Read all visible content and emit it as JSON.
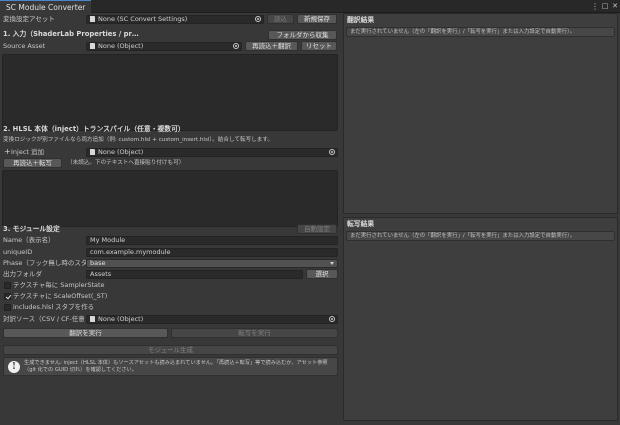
{
  "window": {
    "tab_title": "SC Module Converter",
    "menu_glyph": "⋮",
    "maximize_glyph": "□",
    "close_glyph": "✕"
  },
  "preset": {
    "label": "変換設定アセット",
    "value": "None (SC Convert Settings)",
    "load_label": "読込",
    "save_new_label": "新規保存"
  },
  "section1": {
    "header": "1. 入力（ShaderLab Properties / pr…",
    "collect_folder_label": "フォルダから収集",
    "source_label": "Source Asset",
    "source_value": "None (Object)",
    "reload_translate_label": "再読込＋翻訳",
    "reset_label": "リセット"
  },
  "section2": {
    "header": "2. HLSL 本体（inject）トランスパイル（任意・複数可）",
    "description": "変換ロジックが別ファイルなら両方追加（例: custom.hlsl + custom_insert.hlsl）。結合して転写します。",
    "inject_add_label": "Inject 追加",
    "inject_value": "None (Object)",
    "reload_transcribe_label": "再読込＋転写",
    "note": "（未読込。下のテキストへ直接貼り付けも可）"
  },
  "section3": {
    "header": "3. モジュール設定",
    "auto_setting_label": "自動設定",
    "name_label": "Name（表示名）",
    "name_value": "My Module",
    "uniqueid_label": "uniqueID",
    "uniqueid_value": "com.example.mymodule",
    "phase_label": "Phase（フック無し時のスタブ用",
    "phase_value": "base",
    "output_label": "出力フォルダ",
    "output_value": "Assets",
    "select_label": "選択",
    "checkboxes": [
      {
        "label": "テクスチャ毎に SamplerState",
        "checked": false
      },
      {
        "label": "テクスチャに ScaleOffset(_ST)",
        "checked": true
      },
      {
        "label": "includes.hlsl スタブを作る",
        "checked": false
      }
    ],
    "contrast_label": "対訳ソース（CSV / CF-任意",
    "contrast_value": "None (Object)",
    "run_translate_label": "翻訳を実行",
    "run_transcribe_label": "転写を実行",
    "generate_label": "モジュール生成",
    "help_icon": "!",
    "help_text": "生成できません: inject（HLSL 本体）もソースアセットも読み込まれていません。「再読込＋転写」等で読み込むか、アセット参照（git 化での GUID 切れ）を確認してください。"
  },
  "right": {
    "translation_header": "翻訳結果",
    "translation_message": "まだ実行されていません（左の「翻訳を実行」/「転写を実行」または入力設定で自動実行）。",
    "transcribe_header": "転写結果",
    "transcribe_message": "まだ実行されていません（左の「翻訳を実行」/「転写を実行」または入力設定で自動実行）。"
  }
}
